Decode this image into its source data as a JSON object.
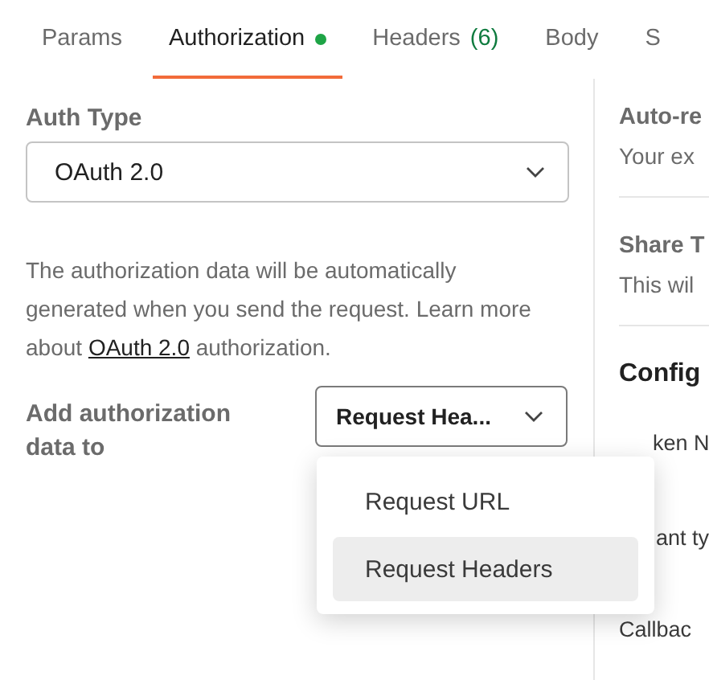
{
  "tabs": [
    {
      "label": "Params",
      "selected": false,
      "dot": false
    },
    {
      "label": "Authorization",
      "selected": true,
      "dot": true
    },
    {
      "label": "Headers",
      "count": "(6)",
      "selected": false,
      "dot": false
    },
    {
      "label": "Body",
      "selected": false,
      "dot": false
    },
    {
      "label": "S",
      "selected": false,
      "dot": false
    }
  ],
  "auth_type": {
    "label": "Auth Type",
    "value": "OAuth 2.0"
  },
  "description": {
    "before": "The authorization data will be automatically generated when you send the request. Learn more about ",
    "link": "OAuth 2.0",
    "after": " authorization."
  },
  "add_to": {
    "label": "Add authorization data to",
    "value": "Request Hea...",
    "expanded": true,
    "options": [
      {
        "label": "Request URL",
        "selected": false
      },
      {
        "label": "Request Headers",
        "selected": true
      }
    ]
  },
  "right_panel": {
    "auto_refresh_title": "Auto-re",
    "auto_refresh_text": "Your ex",
    "share_title": "Share T",
    "share_text": "This wil",
    "config_title": "Config",
    "token_label": "ken N",
    "grant_label": "ant ty",
    "callback_label": "Callbac"
  }
}
